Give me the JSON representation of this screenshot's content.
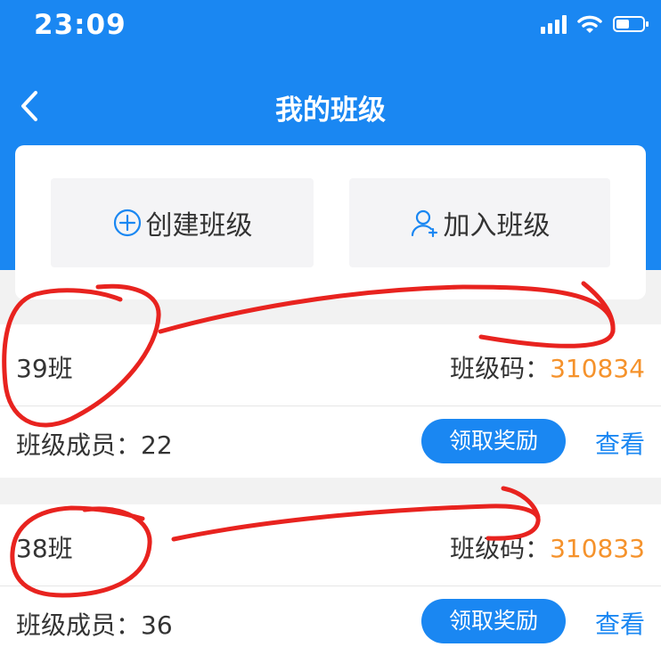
{
  "status_bar": {
    "time": "23:09",
    "icons": [
      "signal-icon",
      "wifi-icon",
      "battery-icon"
    ]
  },
  "nav": {
    "back_icon": "chevron-left-icon",
    "title": "我的班级"
  },
  "actions": {
    "create": {
      "icon": "plus-circle-icon",
      "label": "创建班级"
    },
    "join": {
      "icon": "add-user-icon",
      "label": "加入班级"
    }
  },
  "classes": [
    {
      "name": "39班",
      "code_label": "班级码：",
      "code": "310834",
      "members_label": "班级成员：",
      "members": "22",
      "reward_label": "领取奖励",
      "view_label": "查看"
    },
    {
      "name": "38班",
      "code_label": "班级码：",
      "code": "310833",
      "members_label": "班级成员：",
      "members": "36",
      "reward_label": "领取奖励",
      "view_label": "查看"
    }
  ],
  "colors": {
    "primary_blue": "#1a87f2",
    "code_orange": "#f5922b",
    "annotation_red": "#e8231f",
    "page_bg": "#f2f2f2"
  }
}
